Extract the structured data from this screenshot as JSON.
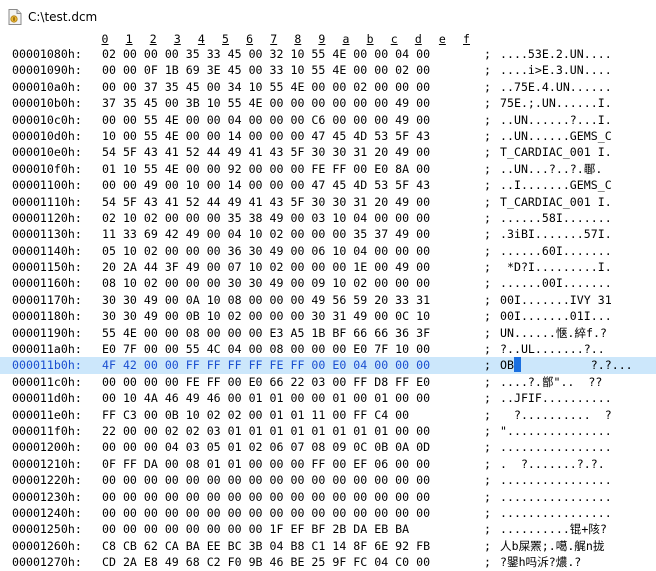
{
  "window": {
    "title": "C:\\test.dcm",
    "icon": "document-icon"
  },
  "ruler": [
    "0",
    "1",
    "2",
    "3",
    "4",
    "5",
    "6",
    "7",
    "8",
    "9",
    "a",
    "b",
    "c",
    "d",
    "e",
    "f"
  ],
  "selected_row": 14,
  "rows": [
    {
      "addr": "00001080h:",
      "hex": "02 00 00 00 35 33 45 00 32 10 55 4E 00 00 04 00",
      "ascii": "....53E.2.UN...."
    },
    {
      "addr": "00001090h:",
      "hex": "00 00 0F 1B 69 3E 45 00 33 10 55 4E 00 00 02 00",
      "ascii": "....i>E.3.UN...."
    },
    {
      "addr": "000010a0h:",
      "hex": "00 00 37 35 45 00 34 10 55 4E 00 00 02 00 00 00",
      "ascii": "..75E.4.UN......"
    },
    {
      "addr": "000010b0h:",
      "hex": "37 35 45 00 3B 10 55 4E 00 00 00 00 00 00 49 00",
      "ascii": "75E.;.UN......I."
    },
    {
      "addr": "000010c0h:",
      "hex": "00 00 55 4E 00 00 04 00 00 00 C6 00 00 00 49 00",
      "ascii": "..UN......?...I."
    },
    {
      "addr": "000010d0h:",
      "hex": "10 00 55 4E 00 00 14 00 00 00 47 45 4D 53 5F 43",
      "ascii": "..UN......GEMS_C"
    },
    {
      "addr": "000010e0h:",
      "hex": "54 5F 43 41 52 44 49 41 43 5F 30 30 31 20 49 00",
      "ascii": "T_CARDIAC_001 I."
    },
    {
      "addr": "000010f0h:",
      "hex": "01 10 55 4E 00 00 92 00 00 00 FE FF 00 E0 8A 00",
      "ascii": "..UN...?..?.鄳."
    },
    {
      "addr": "00001100h:",
      "hex": "00 00 49 00 10 00 14 00 00 00 47 45 4D 53 5F 43",
      "ascii": "..I.......GEMS_C"
    },
    {
      "addr": "00001110h:",
      "hex": "54 5F 43 41 52 44 49 41 43 5F 30 30 31 20 49 00",
      "ascii": "T_CARDIAC_001 I."
    },
    {
      "addr": "00001120h:",
      "hex": "02 10 02 00 00 00 35 38 49 00 03 10 04 00 00 00",
      "ascii": "......58I......."
    },
    {
      "addr": "00001130h:",
      "hex": "11 33 69 42 49 00 04 10 02 00 00 00 35 37 49 00",
      "ascii": ".3iBI.......57I."
    },
    {
      "addr": "00001140h:",
      "hex": "05 10 02 00 00 00 36 30 49 00 06 10 04 00 00 00",
      "ascii": "......60I......."
    },
    {
      "addr": "00001150h:",
      "hex": "20 2A 44 3F 49 00 07 10 02 00 00 00 1E 00 49 00",
      "ascii": " *D?I.........I."
    },
    {
      "addr": "00001160h:",
      "hex": "08 10 02 00 00 00 30 30 49 00 09 10 02 00 00 00",
      "ascii": "......00I......."
    },
    {
      "addr": "00001170h:",
      "hex": "30 30 49 00 0A 10 08 00 00 00 49 56 59 20 33 31",
      "ascii": "00I.......IVY 31"
    },
    {
      "addr": "00001180h:",
      "hex": "30 30 49 00 0B 10 02 00 00 00 30 31 49 00 0C 10",
      "ascii": "00I.......01I..."
    },
    {
      "addr": "00001190h:",
      "hex": "55 4E 00 00 08 00 00 00 E3 A5 1B BF 66 66 36 3F",
      "ascii": "UN......惬.綷f.?"
    },
    {
      "addr": "000011a0h:",
      "hex": "E0 7F 00 00 55 4C 04 00 08 00 00 00 E0 7F 10 00",
      "ascii": "?..UL.......?.."
    },
    {
      "addr": "000011b0h:",
      "hex": "4F 42 00 00 FF FF FF FF FE FF 00 E0 04 00 00 00",
      "ascii": "OB          ?.?..."
    },
    {
      "addr": "000011c0h:",
      "hex": "00 00 00 00 FE FF 00 E0 66 22 03 00 FF D8 FF E0",
      "ascii": "....?.鄫\"..  ??"
    },
    {
      "addr": "000011d0h:",
      "hex": "00 10 4A 46 49 46 00 01 01 00 00 01 00 01 00 00",
      "ascii": "..JFIF.........."
    },
    {
      "addr": "000011e0h:",
      "hex": "FF C3 00 0B 10 02 02 00 01 01 11 00 FF C4 00",
      "ascii": "  ?..........  ?"
    },
    {
      "addr": "000011f0h:",
      "hex": "22 00 00 02 02 03 01 01 01 01 01 01 01 01 00 00",
      "ascii": "\"..............."
    },
    {
      "addr": "00001200h:",
      "hex": "00 00 00 04 03 05 01 02 06 07 08 09 0C 0B 0A 0D",
      "ascii": "................"
    },
    {
      "addr": "00001210h:",
      "hex": "0F FF DA 00 08 01 01 00 00 00 FF 00 EF 06 00 00",
      "ascii": ".  ?.......?.?."
    },
    {
      "addr": "00001220h:",
      "hex": "00 00 00 00 00 00 00 00 00 00 00 00 00 00 00 00",
      "ascii": "................"
    },
    {
      "addr": "00001230h:",
      "hex": "00 00 00 00 00 00 00 00 00 00 00 00 00 00 00 00",
      "ascii": "................"
    },
    {
      "addr": "00001240h:",
      "hex": "00 00 00 00 00 00 00 00 00 00 00 00 00 00 00 00",
      "ascii": "................"
    },
    {
      "addr": "00001250h:",
      "hex": "00 00 00 00 00 00 00 00 1F EF BF 2B DA EB BA",
      "ascii": "..........锟+陔?"
    },
    {
      "addr": "00001260h:",
      "hex": "C8 CB 62 CA BA EE BC 3B 04 B8 C1 14 8F 6E 92 FB",
      "ascii": "人b屎罴;.噶.艉n拢"
    },
    {
      "addr": "00001270h:",
      "hex": "CD 2A E8 49 68 C2 F0 9B 46 BE 25 9F FC 04 C0 00",
      "ascii": "?鑍h吗泝?燶.?"
    }
  ]
}
